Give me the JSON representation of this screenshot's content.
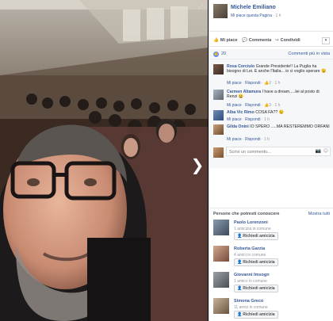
{
  "post": {
    "author": "Michele Emiliano",
    "like_page": "Mi piace questa Pagina",
    "separator": " · ",
    "time": "1 h"
  },
  "actions": {
    "like": "Mi piace",
    "comment": "Commenta",
    "share": "Condividi"
  },
  "likes": {
    "count": "20",
    "more_comments": "Commenti più in vista"
  },
  "comments": [
    {
      "name": "Rosa Corciulo",
      "text": "Grande Presidente!! La Puglia ha bisogno di Lei. E anche l'Italia... io ci voglio sperare",
      "emoji": "😉",
      "meta_like": "Mi piace",
      "meta_reply": "Rispondi",
      "meta_count": "2",
      "meta_time": "1 h"
    },
    {
      "name": "Carmen Altamura",
      "text": "I have a dream.....lei al posto di Renzi",
      "emoji": "😀",
      "meta_like": "Mi piace",
      "meta_reply": "Rispondi",
      "meta_count": "3",
      "meta_time": "1 h"
    },
    {
      "name": "Alba Vic Rimo",
      "text": "COSA FA??",
      "emoji": "😉",
      "meta_like": "Mi piace",
      "meta_reply": "Rispondi",
      "meta_time": "1 h"
    },
    {
      "name": "Gilda Onini",
      "text": "IO SPERO .....MA RESTEREMMO ORFANI",
      "meta_like": "Mi piace",
      "meta_reply": "Rispondi",
      "meta_time": "1 h"
    }
  ],
  "comment_input": {
    "placeholder": "Scrivi un commento..."
  },
  "pymk": {
    "title": "Persone che potresti conoscere",
    "see_all": "Mostra tutti",
    "people": [
      {
        "name": "Paolo Lorenzoni",
        "mutual": "1 amicizia in comune",
        "button": "Richiedi amicizia"
      },
      {
        "name": "Roberta Garzia",
        "mutual": "4 amici in comune",
        "button": "Richiedi amicizia"
      },
      {
        "name": "Giovanni Imsogn",
        "mutual": "1 amico in comune",
        "button": "Richiedi amicizia"
      },
      {
        "name": "Simona Greco",
        "mutual": "11 amici in comune",
        "button": "Richiedi amicizia"
      }
    ]
  },
  "colors": {
    "link": "#365899",
    "like_blue": "#5890ff",
    "muted": "#90949c"
  },
  "icons": {
    "like": "thumbs-up-icon",
    "comment": "speech-bubble-icon",
    "share": "share-arrow-icon",
    "camera": "camera-icon",
    "emoji": "smiley-icon",
    "add_friend": "add-friend-icon"
  }
}
